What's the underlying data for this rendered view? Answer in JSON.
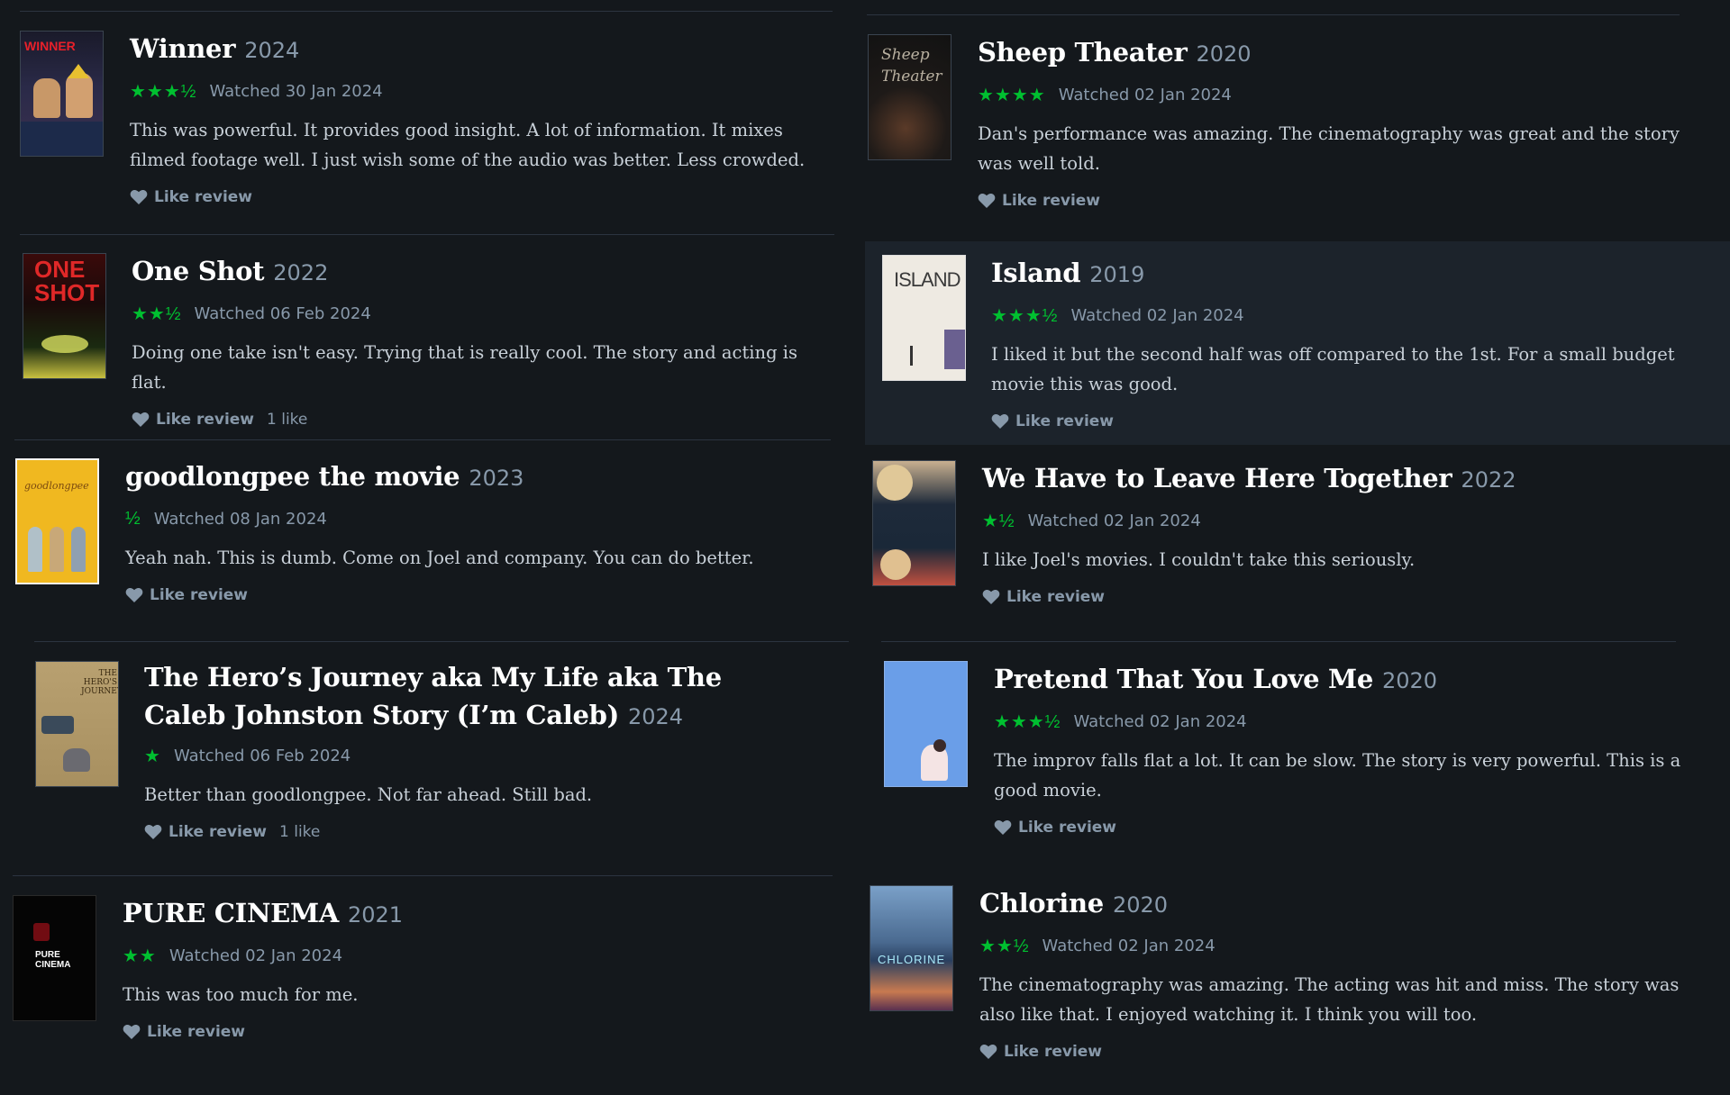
{
  "left": [
    {
      "title": "Winner",
      "year": "2024",
      "stars": "★★★½",
      "watched": "Watched 30 Jan 2024",
      "body": "This was powerful. It provides good insight. A lot of information. It mixes filmed footage well. I just wish some of the audio was better. Less crowded.",
      "like_label": "Like review",
      "like_count": "",
      "poster_text": "WINNER"
    },
    {
      "title": "One Shot",
      "year": "2022",
      "stars": "★★½",
      "watched": "Watched 06 Feb 2024",
      "body": "Doing one take isn't easy. Trying that is really cool. The story and acting is flat.",
      "like_label": "Like review",
      "like_count": "1 like",
      "poster_text": "ONE SHOT"
    },
    {
      "title": "goodlongpee the movie",
      "year": "2023",
      "stars": "½",
      "watched": "Watched 08 Jan 2024",
      "body": "Yeah nah. This is dumb. Come on Joel and company. You can do better.",
      "like_label": "Like review",
      "like_count": "",
      "poster_text": "goodlongpee"
    },
    {
      "title": "The Hero’s Journey aka My Life aka The Caleb Johnston Story (I’m Caleb)",
      "year": "2024",
      "stars": "★",
      "watched": "Watched 06 Feb 2024",
      "body": "Better than goodlongpee. Not far ahead. Still bad.",
      "like_label": "Like review",
      "like_count": "1 like",
      "poster_text": "THE HERO'S JOURNEY"
    },
    {
      "title": "PURE CINEMA",
      "year": "2021",
      "stars": "★★",
      "watched": "Watched 02 Jan 2024",
      "body": "This was too much for me.",
      "like_label": "Like review",
      "like_count": "",
      "poster_text": "PURE CINEMA"
    }
  ],
  "right": [
    {
      "title": "Sheep Theater",
      "year": "2020",
      "stars": "★★★★",
      "watched": "Watched 02 Jan 2024",
      "body": "Dan's performance was amazing. The cinematography was great and the story was well told.",
      "like_label": "Like review",
      "like_count": "",
      "poster_text": "Sheep Theater"
    },
    {
      "title": "Island",
      "year": "2019",
      "stars": "★★★½",
      "watched": "Watched 02 Jan 2024",
      "body": "I liked it but the second half was off compared to the 1st. For a small budget movie this was good.",
      "like_label": "Like review",
      "like_count": "",
      "poster_text": "ISLAND"
    },
    {
      "title": "We Have to Leave Here Together",
      "year": "2022",
      "stars": "★½",
      "watched": "Watched 02 Jan 2024",
      "body": "I like Joel's movies. I couldn't take this seriously.",
      "like_label": "Like review",
      "like_count": "",
      "poster_text": ""
    },
    {
      "title": "Pretend That You Love Me",
      "year": "2020",
      "stars": "★★★½",
      "watched": "Watched 02 Jan 2024",
      "body": "The improv falls flat a lot. It can be slow. The story is very powerful. This is a good movie.",
      "like_label": "Like review",
      "like_count": "",
      "poster_text": ""
    },
    {
      "title": "Chlorine",
      "year": "2020",
      "stars": "★★½",
      "watched": "Watched 02 Jan 2024",
      "body": "The cinematography was amazing. The acting was hit and miss. The story was also like that. I enjoyed watching it. I think you will too.",
      "like_label": "Like review",
      "like_count": "",
      "poster_text": "CHLORINE"
    }
  ],
  "colors": {
    "background": "#14181c",
    "star": "#00c030",
    "muted": "#8899aa",
    "text": "#c8d0d8"
  }
}
